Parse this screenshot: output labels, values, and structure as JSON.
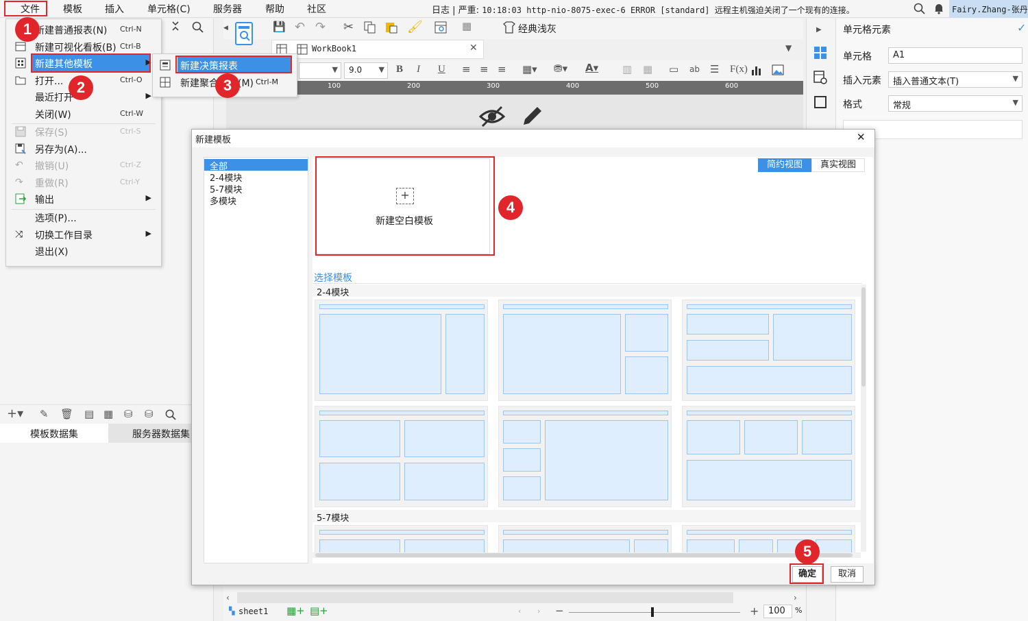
{
  "menubar": {
    "items": [
      "文件",
      "模板",
      "插入",
      "单元格(C)",
      "服务器",
      "帮助",
      "社区"
    ],
    "status_log": "日志",
    "status_level": "严重:",
    "status_message": "10:18:03 http-nio-8075-exec-6 ERROR [standard] 远程主机强迫关闭了一个现有的连接。",
    "user": "Fairy.Zhang-张丹"
  },
  "file_menu": {
    "items": [
      {
        "label": "新建普通报表(N)",
        "shortcut": "Ctrl-N",
        "enabled": true
      },
      {
        "label": "新建可视化看板(B)",
        "shortcut": "Ctrl-B",
        "enabled": true
      },
      {
        "label": "新建其他模板",
        "shortcut": "",
        "enabled": true,
        "submenu": true
      },
      {
        "label": "打开...",
        "shortcut": "Ctrl-O",
        "enabled": true
      },
      {
        "label": "最近打开",
        "shortcut": "",
        "enabled": true,
        "submenu": true
      },
      {
        "label": "关闭(W)",
        "shortcut": "Ctrl-W",
        "enabled": true
      },
      {
        "label": "保存(S)",
        "shortcut": "Ctrl-S",
        "enabled": false
      },
      {
        "label": "另存为(A)...",
        "shortcut": "",
        "enabled": true
      },
      {
        "label": "撤销(U)",
        "shortcut": "Ctrl-Z",
        "enabled": false
      },
      {
        "label": "重做(R)",
        "shortcut": "Ctrl-Y",
        "enabled": false
      },
      {
        "label": "输出",
        "shortcut": "",
        "enabled": true,
        "submenu": true
      },
      {
        "label": "选项(P)...",
        "shortcut": "",
        "enabled": true
      },
      {
        "label": "切换工作目录",
        "shortcut": "",
        "enabled": true,
        "submenu": true
      },
      {
        "label": "退出(X)",
        "shortcut": "",
        "enabled": true
      }
    ]
  },
  "submenu": {
    "items": [
      {
        "label": "新建决策报表",
        "shortcut": ""
      },
      {
        "label": "新建聚合报表(M)",
        "shortcut": "Ctrl-M"
      }
    ]
  },
  "toolbar": {
    "theme_label": "经典浅灰"
  },
  "workbook": {
    "tab": "WorkBook1"
  },
  "format": {
    "font_size": "9.0"
  },
  "ruler": {
    "ticks": [
      "100",
      "200",
      "300",
      "400",
      "500",
      "600"
    ]
  },
  "right_panel": {
    "title": "单元格元素",
    "cell_label": "单元格",
    "cell_value": "A1",
    "insert_label": "插入元素",
    "insert_value": "插入普通文本(T)",
    "format_label": "格式",
    "format_value": "常规"
  },
  "left_pane": {
    "tabs": [
      "模板数据集",
      "服务器数据集"
    ]
  },
  "dialog": {
    "title": "新建模板",
    "categories": [
      "全部",
      "2-4模块",
      "5-7模块",
      "多模块"
    ],
    "view_toggle": {
      "simple": "简约视图",
      "real": "真实视图"
    },
    "blank_template_label": "新建空白模板",
    "section_select": "选择模板",
    "group_2_4": "2-4模块",
    "group_5_7": "5-7模块",
    "ok_label": "确定",
    "cancel_label": "取消"
  },
  "sheet": {
    "name": "sheet1",
    "zoom": "100",
    "zoom_unit": "%"
  },
  "badges": [
    "1",
    "2",
    "3",
    "4",
    "5"
  ],
  "colors": {
    "accent": "#3c91e6",
    "highlight_red": "#e1262b",
    "tile_fill": "#dfeeff",
    "tile_border": "#9cc5f2"
  }
}
